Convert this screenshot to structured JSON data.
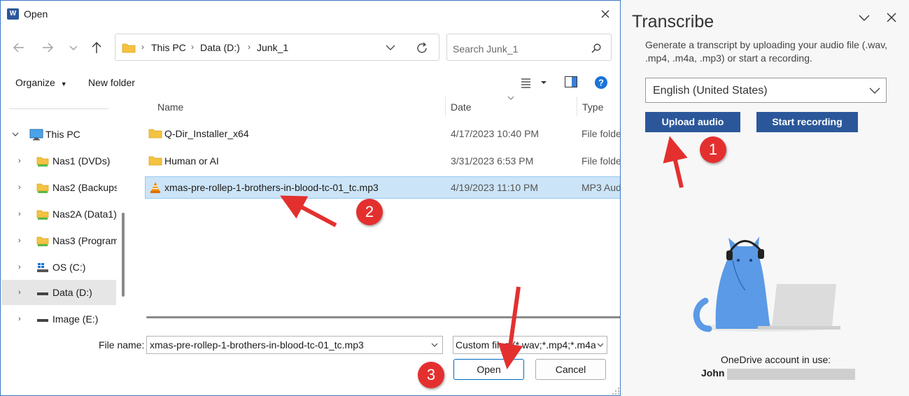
{
  "dialog": {
    "title": "Open",
    "app_icon_letter": "W",
    "breadcrumbs": [
      "This PC",
      "Data (D:)",
      "Junk_1"
    ],
    "search_placeholder": "Search Junk_1",
    "toolbar": {
      "organize": "Organize",
      "new_folder": "New folder"
    },
    "nav_items": [
      {
        "label": "This PC",
        "icon": "monitor-icon"
      },
      {
        "label": "Nas1 (DVDs)",
        "icon": "network-drive-icon"
      },
      {
        "label": "Nas2 (Backups",
        "icon": "network-drive-icon"
      },
      {
        "label": "Nas2A (Data1)",
        "icon": "network-drive-icon"
      },
      {
        "label": "Nas3 (Program",
        "icon": "network-drive-icon"
      },
      {
        "label": "OS (C:)",
        "icon": "windows-drive-icon"
      },
      {
        "label": "Data (D:)",
        "icon": "drive-icon"
      },
      {
        "label": "Image (E:)",
        "icon": "drive-icon"
      }
    ],
    "columns": {
      "name": "Name",
      "date": "Date",
      "type": "Type"
    },
    "files": [
      {
        "name": "Q-Dir_Installer_x64",
        "date": "4/17/2023 10:40 PM",
        "type": "File folde",
        "icon": "folder-icon"
      },
      {
        "name": "Human or AI",
        "date": "3/31/2023 6:53 PM",
        "type": "File folde",
        "icon": "folder-icon"
      },
      {
        "name": "xmas-pre-rollep-1-brothers-in-blood-tc-01_tc.mp3",
        "date": "4/19/2023 11:10 PM",
        "type": "MP3 Aud",
        "icon": "vlc-cone-icon"
      }
    ],
    "file_name_label": "File name:",
    "file_name_value": "xmas-pre-rollep-1-brothers-in-blood-tc-01_tc.mp3",
    "file_type_value": "Custom files (*.wav;*.mp4;*.m4a",
    "open_label": "Open",
    "cancel_label": "Cancel"
  },
  "transcribe": {
    "title": "Transcribe",
    "description": "Generate a transcript by uploading your audio file (.wav, .mp4, .m4a, .mp3) or start a recording.",
    "language": "English (United States)",
    "upload_label": "Upload audio",
    "record_label": "Start recording",
    "account_label": "OneDrive account in use:",
    "account_name": "John"
  },
  "annotations": [
    "1",
    "2",
    "3"
  ],
  "colors": {
    "accent": "#2b579a",
    "selection": "#cce4f7",
    "badge": "#e3302f"
  }
}
